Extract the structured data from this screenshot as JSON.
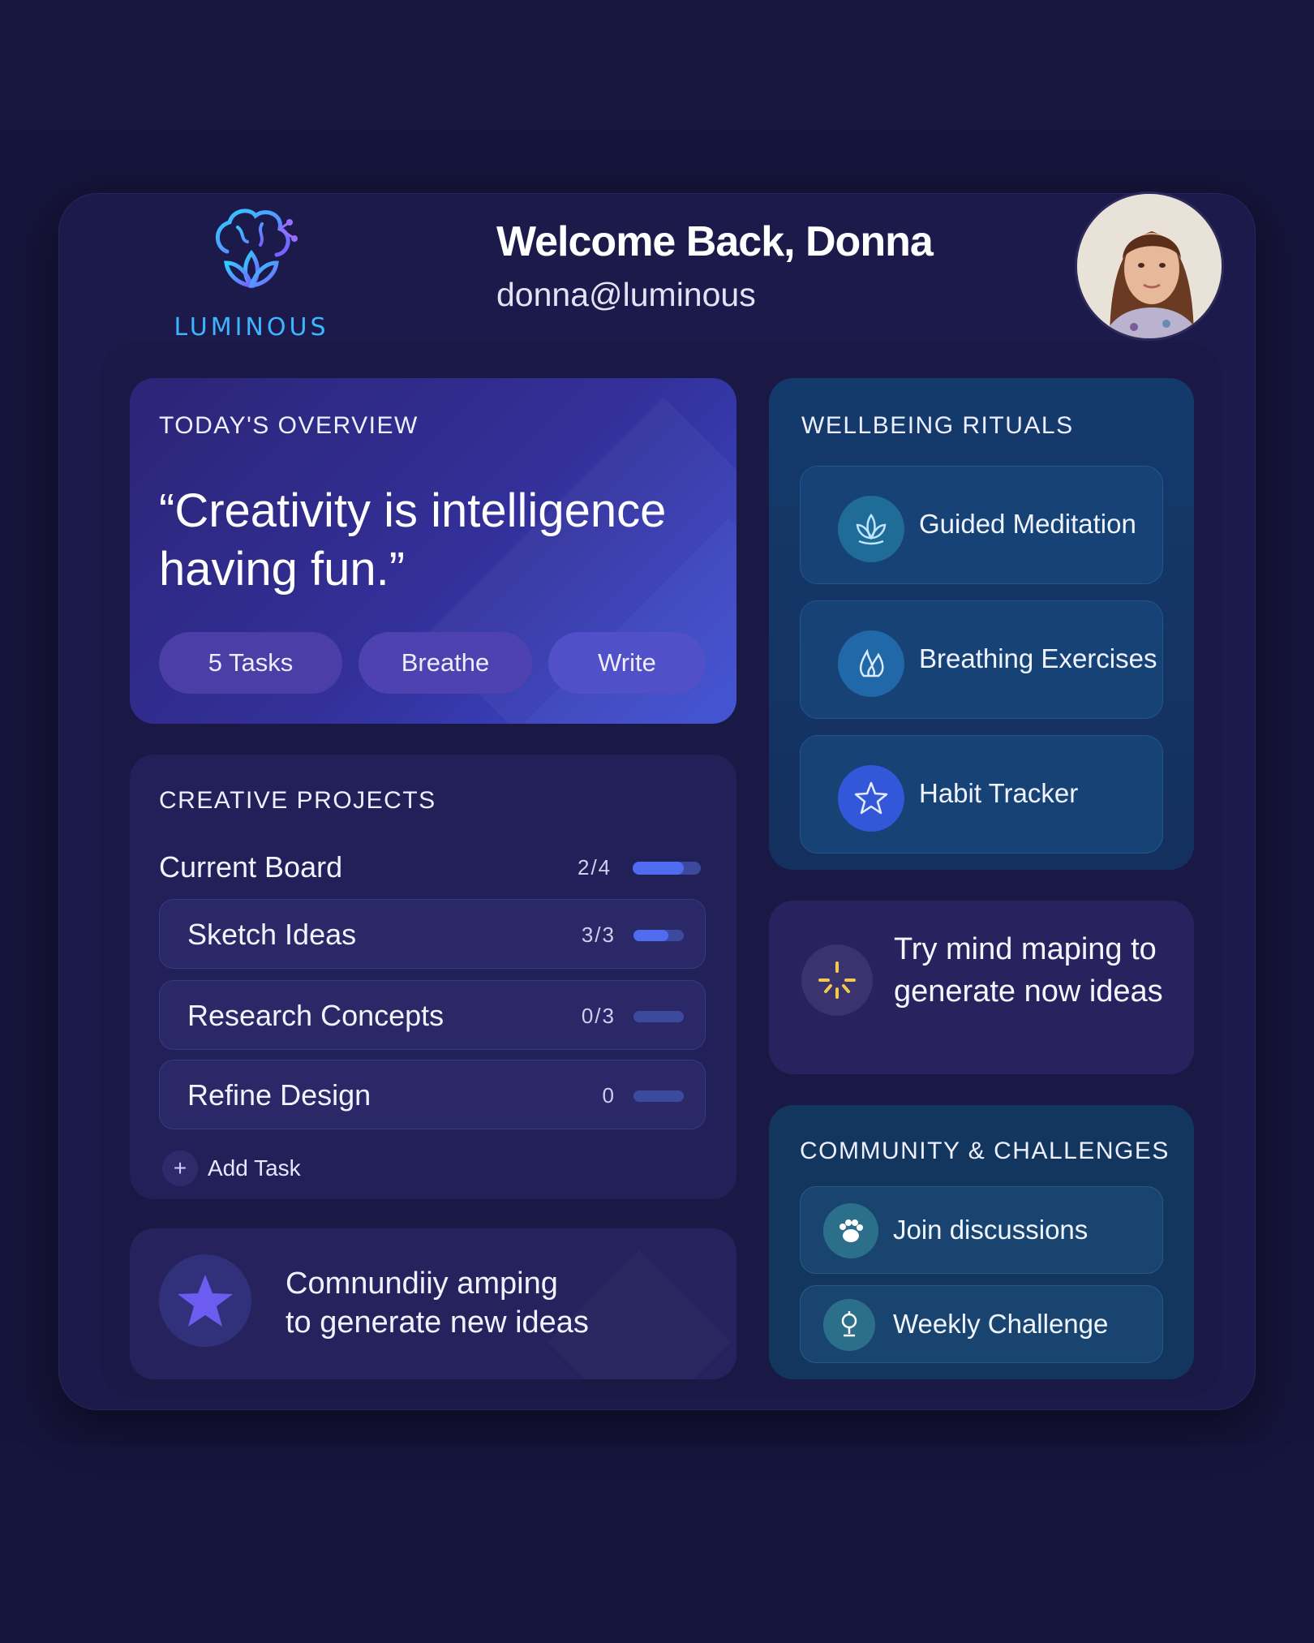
{
  "brand": {
    "name": "LUMINOUS"
  },
  "header": {
    "welcome": "Welcome Back, Donna",
    "email": "donna@luminous"
  },
  "overview": {
    "title": "TODAY'S OVERVIEW",
    "quote": "“Creativity is intelligence having fun.”",
    "pills": [
      "5  Tasks",
      "Breathe",
      "Write"
    ]
  },
  "projects": {
    "title": "CREATIVE PROJECTS",
    "board": {
      "label": "Current Board",
      "count": "2/4",
      "progress": 0.75
    },
    "items": [
      {
        "label": "Sketch Ideas",
        "count": "3/3",
        "progress": 0.7
      },
      {
        "label": "Research Concepts",
        "count": "0/3",
        "progress": 0
      },
      {
        "label": "Refine Design",
        "count": "0",
        "progress": 0
      }
    ],
    "add_task": "Add Task"
  },
  "community_card": {
    "text_line1": "Comnundiiy amping",
    "text_line2": "to generate new ideas"
  },
  "wellbeing": {
    "title": "WELLBEING RITUALS",
    "items": [
      {
        "label": "Guided Meditation",
        "icon": "lotus-hands-icon"
      },
      {
        "label": "Breathing Exercises",
        "icon": "flame-icon"
      },
      {
        "label": "Habit Tracker",
        "icon": "star-icon"
      }
    ]
  },
  "mindmap": {
    "text": "Try mind maping to generate now ideas"
  },
  "challenges": {
    "title": "COMMUNITY & CHALLENGES",
    "items": [
      {
        "label": "Join discussions",
        "icon": "paw-icon"
      },
      {
        "label": "Weekly Challenge",
        "icon": "trophy-icon"
      }
    ]
  },
  "colors": {
    "background": "#15143a",
    "accent": "#4f6cf0",
    "logo": "#3cb6ff"
  }
}
